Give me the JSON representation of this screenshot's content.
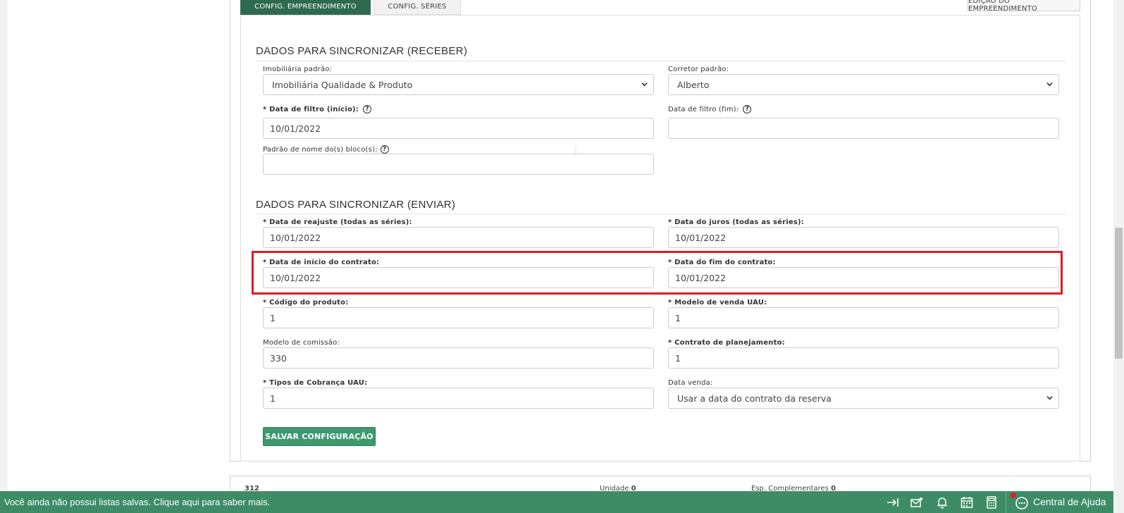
{
  "tabs": {
    "active": "CONFIG. EMPREENDIMENTO",
    "inactive": "CONFIG. SÉRIES",
    "edit_button": "EDIÇÃO DO EMPREENDIMENTO"
  },
  "receive": {
    "title": "DADOS PARA SINCRONIZAR (RECEBER)",
    "realestate_label": "Imobiliária padrão:",
    "realestate_value": "Imobiliária Qualidade & Produto",
    "broker_label": "Corretor padrão:",
    "broker_value": "Alberto",
    "filter_start_label": "* Data de filtro (início):",
    "filter_start_value": "10/01/2022",
    "filter_end_label": "Data de filtro (fim):",
    "filter_end_value": "",
    "block_pattern_label": "Padrão de nome do(s) bloco(s):",
    "block_pattern_value": ""
  },
  "send": {
    "title": "DADOS PARA SINCRONIZAR (ENVIAR)",
    "readjust_label": "* Data de reajuste (todas as séries):",
    "readjust_value": "10/01/2022",
    "interest_label": "* Data do juros (todas as séries):",
    "interest_value": "10/01/2022",
    "contract_start_label": "* Data de início do contrato:",
    "contract_start_value": "10/01/2022",
    "contract_end_label": "* Data do fim do contrato:",
    "contract_end_value": "10/01/2022",
    "product_code_label": "* Código do produto:",
    "product_code_value": "1",
    "sale_model_label": "* Modelo de venda UAU:",
    "sale_model_value": "1",
    "commission_label": "Modelo de comissão:",
    "commission_value": "330",
    "planning_label": "* Contrato de planejamento:",
    "planning_value": "1",
    "billing_label": "* Tipos de Cobrança UAU:",
    "billing_value": "1",
    "sale_date_label": "Data venda:",
    "sale_date_value": "Usar a data do contrato da reserva"
  },
  "save_button": "SALVAR CONFIGURAÇÃO",
  "next_row": {
    "code": "312",
    "unit_label": "Unidade",
    "unit_value": "0",
    "extras_label": "Esp. Complementares",
    "extras_value": "0"
  },
  "footer": {
    "message": "Você ainda não possui listas salvas. Clique aqui para saber mais.",
    "help_center": "Central de Ajuda",
    "icons": [
      "arrow-right-bar-icon",
      "mail-star-icon",
      "bell-icon",
      "calendar-icon",
      "calculator-icon",
      "chat-bubble-icon"
    ]
  },
  "colors": {
    "primary_green": "#2d6a4f",
    "footer_green": "#3d8c66",
    "button_green": "#3e9a6e",
    "highlight_red": "#e01b24"
  }
}
